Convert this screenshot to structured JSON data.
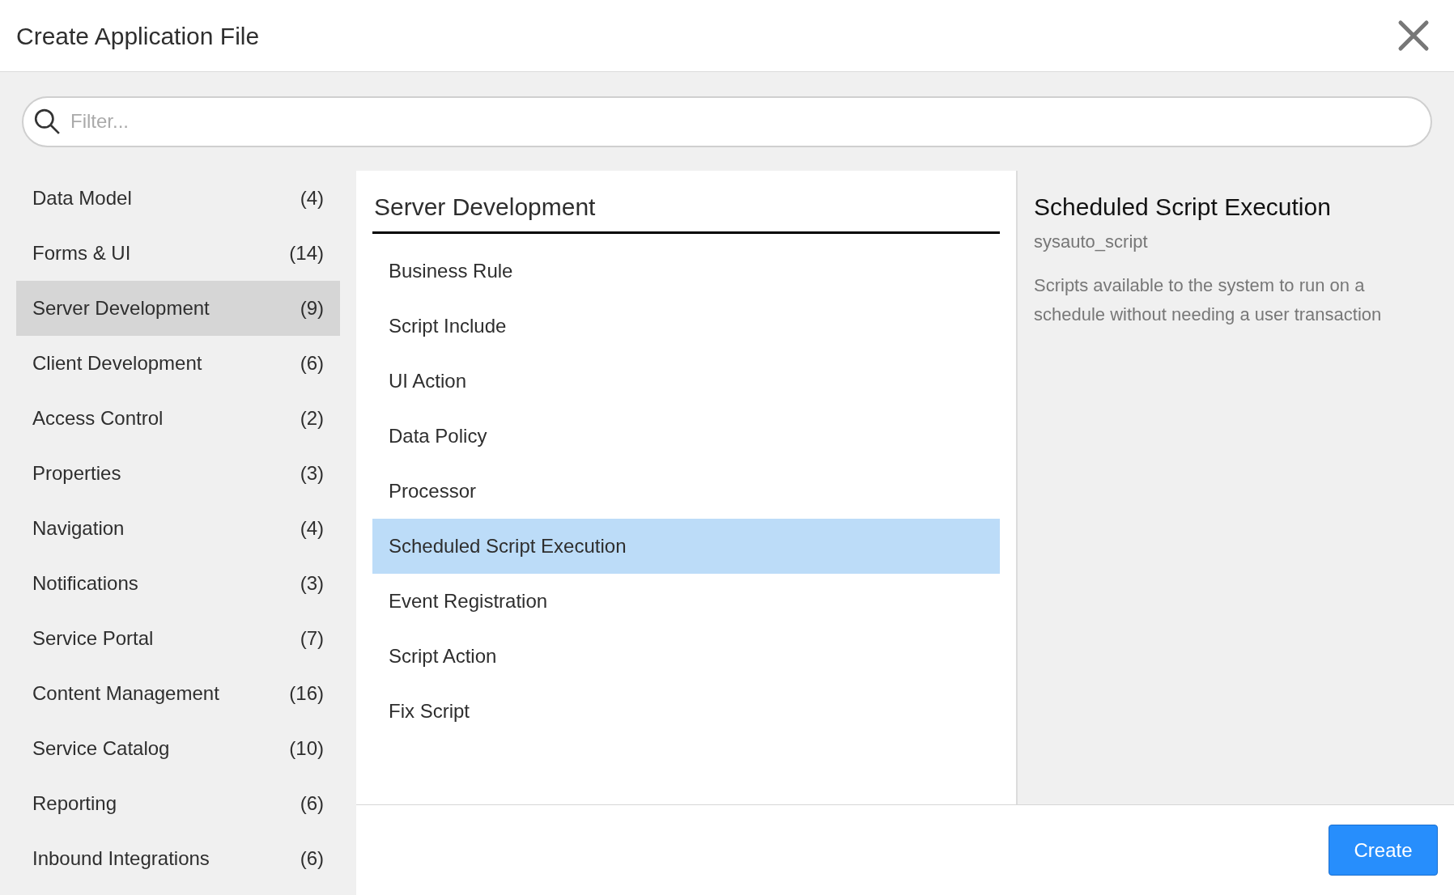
{
  "dialog": {
    "title": "Create Application File"
  },
  "search": {
    "placeholder": "Filter..."
  },
  "categories": [
    {
      "label": "Data Model",
      "count": "(4)",
      "selected": false
    },
    {
      "label": "Forms & UI",
      "count": "(14)",
      "selected": false
    },
    {
      "label": "Server Development",
      "count": "(9)",
      "selected": true
    },
    {
      "label": "Client Development",
      "count": "(6)",
      "selected": false
    },
    {
      "label": "Access Control",
      "count": "(2)",
      "selected": false
    },
    {
      "label": "Properties",
      "count": "(3)",
      "selected": false
    },
    {
      "label": "Navigation",
      "count": "(4)",
      "selected": false
    },
    {
      "label": "Notifications",
      "count": "(3)",
      "selected": false
    },
    {
      "label": "Service Portal",
      "count": "(7)",
      "selected": false
    },
    {
      "label": "Content Management",
      "count": "(16)",
      "selected": false
    },
    {
      "label": "Service Catalog",
      "count": "(10)",
      "selected": false
    },
    {
      "label": "Reporting",
      "count": "(6)",
      "selected": false
    },
    {
      "label": "Inbound Integrations",
      "count": "(6)",
      "selected": false
    }
  ],
  "file_types": {
    "heading": "Server Development",
    "items": [
      {
        "label": "Business Rule",
        "selected": false
      },
      {
        "label": "Script Include",
        "selected": false
      },
      {
        "label": "UI Action",
        "selected": false
      },
      {
        "label": "Data Policy",
        "selected": false
      },
      {
        "label": "Processor",
        "selected": false
      },
      {
        "label": "Scheduled Script Execution",
        "selected": true
      },
      {
        "label": "Event Registration",
        "selected": false
      },
      {
        "label": "Script Action",
        "selected": false
      },
      {
        "label": "Fix Script",
        "selected": false
      }
    ]
  },
  "details": {
    "title": "Scheduled Script Execution",
    "table": "sysauto_script",
    "description": "Scripts available to the system to run on a schedule without needing a user transaction"
  },
  "buttons": {
    "create": "Create"
  }
}
